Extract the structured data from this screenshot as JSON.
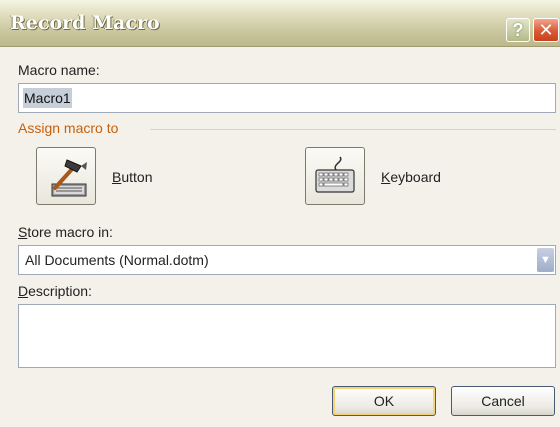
{
  "window": {
    "title": "Record Macro",
    "help_label": "?",
    "close_label": "✕"
  },
  "macro_name": {
    "label": "Macro name:",
    "value": "Macro1"
  },
  "assign": {
    "group_label": "Assign macro to",
    "button_option": {
      "label_prefix": "B",
      "label_rest": "utton",
      "icon": "hammer-icon"
    },
    "keyboard_option": {
      "label_prefix": "K",
      "label_rest": "eyboard",
      "icon": "keyboard-icon"
    }
  },
  "store": {
    "label_prefix": "S",
    "label_rest": "tore macro in:",
    "selected": "All Documents (Normal.dotm)",
    "arrow": "▼"
  },
  "description": {
    "label_prefix": "D",
    "label_rest": "escription:",
    "value": ""
  },
  "buttons": {
    "ok": "OK",
    "cancel": "Cancel"
  },
  "colors": {
    "group_label": "#c8600c",
    "dialog_bg": "#f3f1e9",
    "title_bar": "#c9c59d"
  }
}
